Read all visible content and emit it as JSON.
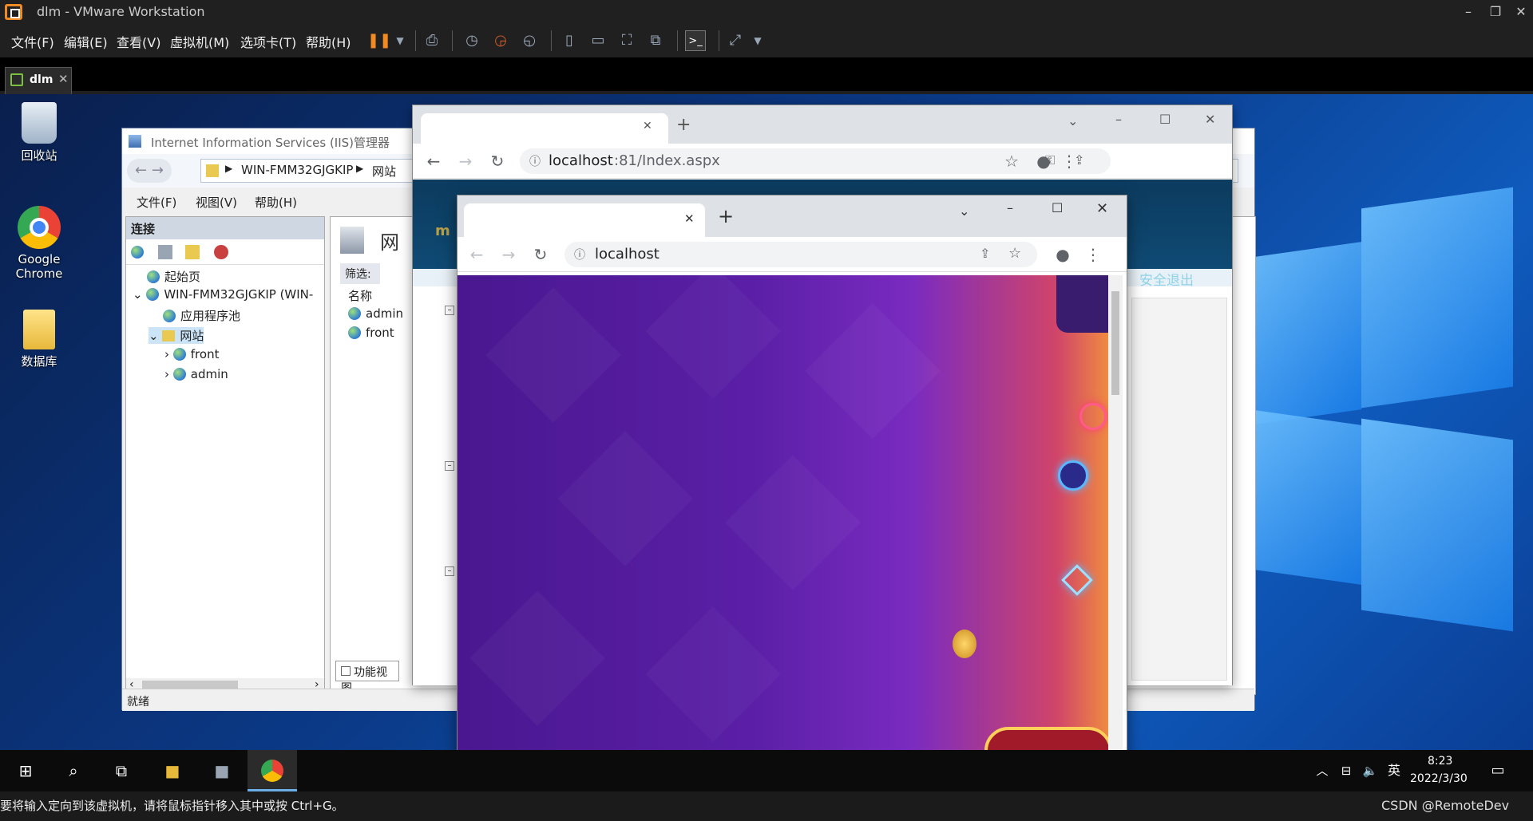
{
  "vmware": {
    "title": "dlm - VMware Workstation",
    "menu": [
      "文件(F)",
      "编辑(E)",
      "查看(V)",
      "虚拟机(M)",
      "选项卡(T)",
      "帮助(H)"
    ],
    "tab_label": "dlm",
    "status_text": "要将输入定向到该虚拟机，请将鼠标指针移入其中或按 Ctrl+G。",
    "watermark": "CSDN @RemoteDev",
    "accent": "#f08a24"
  },
  "desktop": {
    "icons": [
      "回收站",
      "Google Chrome",
      "数据库"
    ]
  },
  "iis": {
    "title": "Internet Information Services (IIS)管理器",
    "breadcrumb_server": "WIN-FMM32GJGKIP",
    "breadcrumb_site": "网站",
    "menu": [
      "文件(F)",
      "视图(V)",
      "帮助(H)"
    ],
    "connections_header": "连接",
    "tree": {
      "start_page": "起始页",
      "server": "WIN-FMM32GJGKIP (WIN-",
      "app_pools": "应用程序池",
      "sites": "网站",
      "site_front": "front",
      "site_admin": "admin"
    },
    "page_heading": "网",
    "filter_label": "筛选:",
    "name_column": "名称",
    "list": [
      "admin",
      "front"
    ],
    "feature_view_tab": "功能视图",
    "status": "就绪"
  },
  "chrome_back": {
    "url_host": "localhost",
    "url_rest": ":81/Index.aspx",
    "banner_text": "m a",
    "logout_text": "安全退出"
  },
  "chrome_front": {
    "url": "localhost"
  },
  "taskbar": {
    "ime": "英",
    "time": "8:23",
    "date": "2022/3/30"
  }
}
